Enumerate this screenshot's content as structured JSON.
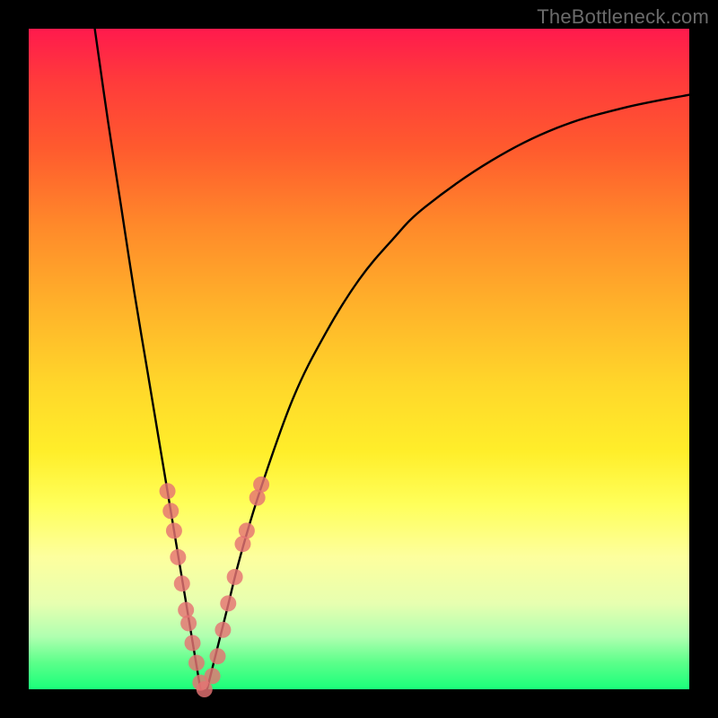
{
  "watermark": "TheBottleneck.com",
  "colors": {
    "background_frame": "#000000",
    "marker": "#e57373",
    "curve": "#000000",
    "gradient_top": "#ff1a4d",
    "gradient_bottom": "#1aff7a"
  },
  "chart_data": {
    "type": "line",
    "title": "",
    "xlabel": "",
    "ylabel": "",
    "xlim": [
      0,
      100
    ],
    "ylim": [
      0,
      100
    ],
    "note": "Bottleneck-style V-curve. Axes and ticks are not shown in the image; values are estimated from geometry. Minimum near x≈26. Markers cluster on both branches near the valley.",
    "series": [
      {
        "name": "left-branch",
        "x": [
          10,
          12,
          14,
          16,
          18,
          20,
          22,
          23,
          24,
          25,
          26
        ],
        "values": [
          100,
          86,
          73,
          60,
          48,
          36,
          24,
          18,
          12,
          6,
          0
        ]
      },
      {
        "name": "right-branch",
        "x": [
          27,
          28,
          30,
          32,
          35,
          40,
          45,
          50,
          55,
          60,
          70,
          80,
          90,
          100
        ],
        "values": [
          0,
          4,
          12,
          20,
          30,
          44,
          54,
          62,
          68,
          73,
          80,
          85,
          88,
          90
        ]
      }
    ],
    "markers": [
      {
        "branch": "left",
        "x": 21.0,
        "y": 30
      },
      {
        "branch": "left",
        "x": 21.5,
        "y": 27
      },
      {
        "branch": "left",
        "x": 22.0,
        "y": 24
      },
      {
        "branch": "left",
        "x": 22.6,
        "y": 20
      },
      {
        "branch": "left",
        "x": 23.2,
        "y": 16
      },
      {
        "branch": "left",
        "x": 23.8,
        "y": 12
      },
      {
        "branch": "left",
        "x": 24.2,
        "y": 10
      },
      {
        "branch": "left",
        "x": 24.8,
        "y": 7
      },
      {
        "branch": "left",
        "x": 25.4,
        "y": 4
      },
      {
        "branch": "left",
        "x": 26.0,
        "y": 1
      },
      {
        "branch": "left",
        "x": 26.6,
        "y": 0
      },
      {
        "branch": "right",
        "x": 27.8,
        "y": 2
      },
      {
        "branch": "right",
        "x": 28.6,
        "y": 5
      },
      {
        "branch": "right",
        "x": 29.4,
        "y": 9
      },
      {
        "branch": "right",
        "x": 30.2,
        "y": 13
      },
      {
        "branch": "right",
        "x": 31.2,
        "y": 17
      },
      {
        "branch": "right",
        "x": 32.4,
        "y": 22
      },
      {
        "branch": "right",
        "x": 33.0,
        "y": 24
      },
      {
        "branch": "right",
        "x": 34.6,
        "y": 29
      },
      {
        "branch": "right",
        "x": 35.2,
        "y": 31
      }
    ]
  }
}
